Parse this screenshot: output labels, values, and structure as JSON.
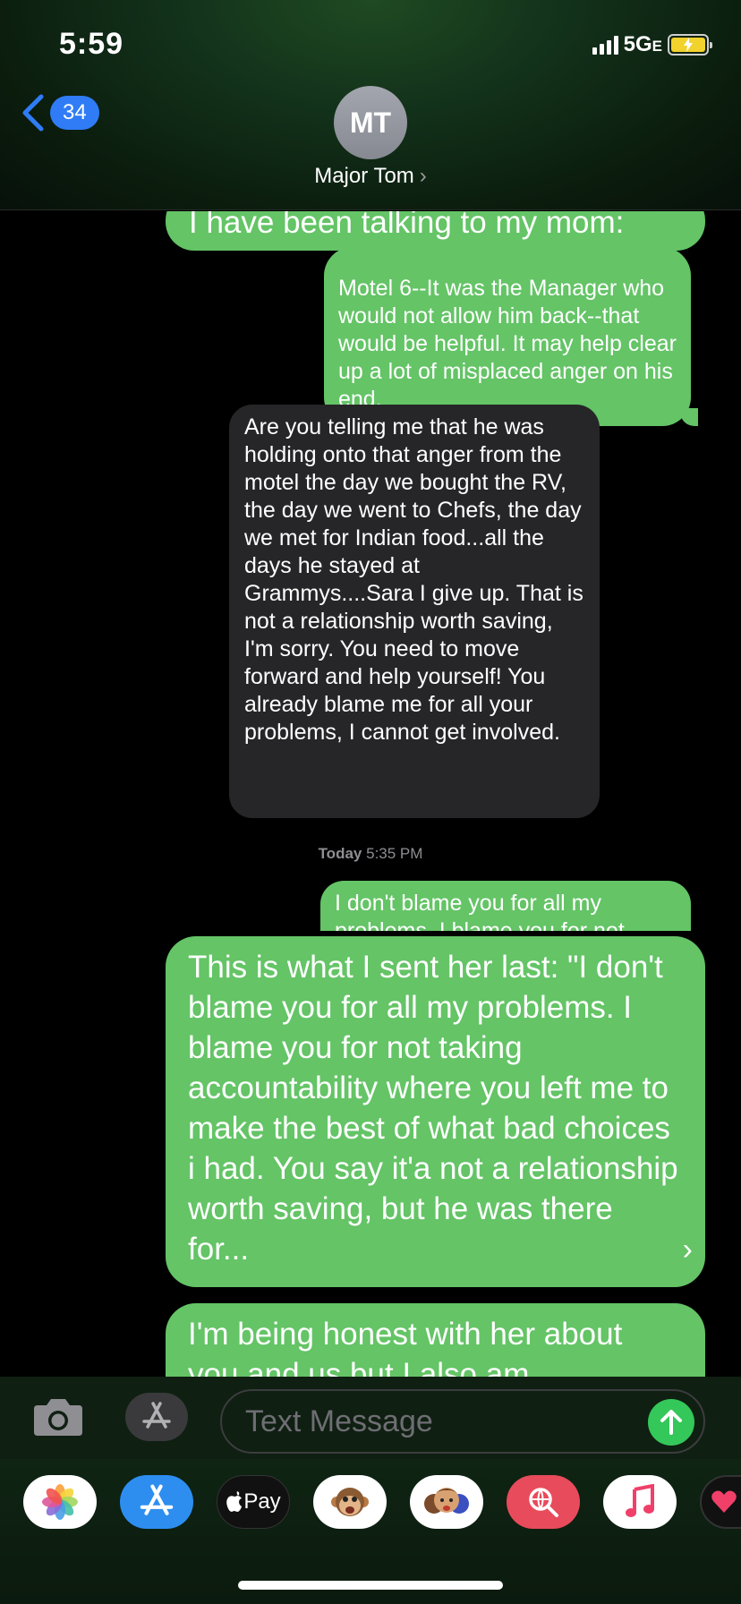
{
  "status_bar": {
    "time": "5:59",
    "network": "5G",
    "network_suffix": "E"
  },
  "header": {
    "back_count": "34",
    "avatar_initials": "MT",
    "contact_name": "Major Tom",
    "contact_chevron": "›"
  },
  "messages": [
    {
      "id": "m1",
      "direction": "sent",
      "text": "I have been talking to my mom:"
    },
    {
      "id": "m2",
      "direction": "sent",
      "text": "Motel 6--It was the Manager who would not allow him back--that would be helpful. It may help clear up a lot of misplaced anger on his end."
    },
    {
      "id": "m3",
      "direction": "received",
      "text": "Are you telling me that he was holding onto that anger from the motel the day we bought the RV, the day we went to Chefs, the day we met for Indian food...all the days he stayed at Grammys....Sara I give up. That is not a relationship worth saving, I'm sorry. You need to move forward and help yourself! You already blame me for all your problems, I cannot get involved."
    },
    {
      "id": "m4",
      "direction": "sent",
      "text": "I don't blame you for all my problems. I blame you for not"
    },
    {
      "id": "m5",
      "direction": "sent",
      "text": "This is what I sent her last: \"I don't blame you for all my problems. I blame you for not taking accountability where you left me to make the best of what bad choices i had. You say it'a not a relationship worth saving, but he was there for...",
      "more": "›"
    },
    {
      "id": "m6",
      "direction": "sent",
      "text": "I'm being honest with her about you and us but I also am"
    }
  ],
  "timestamp": {
    "day": "Today",
    "time": "5:35 PM"
  },
  "composer": {
    "placeholder": "Text Message"
  },
  "app_drawer": {
    "apple_pay_label": "Pay",
    "apps": [
      "photos-icon",
      "app-store-icon",
      "apple-pay-icon",
      "animoji-icon",
      "memoji-icon",
      "images-search-icon",
      "music-icon",
      "heart-icon"
    ]
  },
  "colors": {
    "sent_bubble": "#64c466",
    "received_bubble": "#262628",
    "badge": "#2f7cf6",
    "send_button": "#34c759"
  }
}
